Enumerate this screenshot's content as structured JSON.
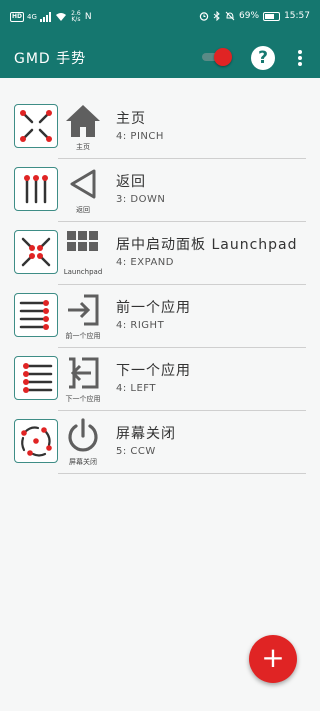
{
  "status_bar": {
    "hd": "HD",
    "network": "4G",
    "net_rate": "2.6 K/s",
    "nfc": "N",
    "battery": "69%",
    "battery_level": 0.69,
    "time": "15:57"
  },
  "app_bar": {
    "title": "GMD 手势",
    "toggle_on": true,
    "help": "?",
    "accent": "#15776f"
  },
  "rows": [
    {
      "title": "主页",
      "gesture": "4: PINCH",
      "tag": "主页",
      "action_icon": "home-icon",
      "gesture_icon": "pinch-gesture-icon"
    },
    {
      "title": "返回",
      "gesture": "3: DOWN",
      "tag": "返回",
      "action_icon": "back-triangle-icon",
      "gesture_icon": "swipe-down-gesture-icon"
    },
    {
      "title": "居中启动面板 Launchpad",
      "gesture": "4: EXPAND",
      "tag": "Launchpad",
      "action_icon": "grid-icon",
      "gesture_icon": "expand-gesture-icon"
    },
    {
      "title": "前一个应用",
      "gesture": "4: RIGHT",
      "tag": "前一个应用",
      "action_icon": "arrow-into-box-icon",
      "gesture_icon": "swipe-right-gesture-icon"
    },
    {
      "title": "下一个应用",
      "gesture": "4: LEFT",
      "tag": "下一个应用",
      "action_icon": "arrow-out-box-icon",
      "gesture_icon": "swipe-left-gesture-icon"
    },
    {
      "title": "屏幕关闭",
      "gesture": "5: CCW",
      "tag": "屏幕关闭",
      "action_icon": "power-icon",
      "gesture_icon": "rotate-ccw-gesture-icon"
    }
  ],
  "fab": {
    "label": "+",
    "color": "#e02424"
  }
}
